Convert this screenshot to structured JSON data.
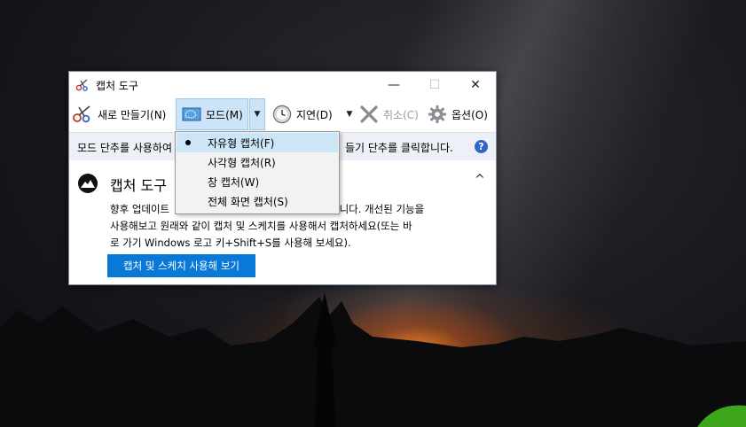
{
  "window": {
    "title": "캡처 도구",
    "minimize": "—",
    "maximize": "☐",
    "close": "✕"
  },
  "toolbar": {
    "new_label": "새로 만들기(N)",
    "mode_label": "모드(M)",
    "delay_label": "지연(D)",
    "cancel_label": "취소(C)",
    "options_label": "옵션(O)",
    "dropdown_caret": "▼"
  },
  "infobar": {
    "text_left": "모드 단추를 사용하여",
    "text_right": "들기 단추를 클릭합니다.",
    "help": "?"
  },
  "panel": {
    "heading": "캡처 도구",
    "collapse": "^",
    "line1_left": "향후 업데이트",
    "line1_right": "됩니다. 개선된 기능을",
    "line2": "사용해보고 원래와 같이 캡처 및 스케치를 사용해서 캡처하세요(또는 바",
    "line3": "로 가기 Windows 로고 키+Shift+S를 사용해 보세요).",
    "cta_label": "캡처 및 스케치 사용해 보기"
  },
  "mode_menu": {
    "items": [
      {
        "label": "자유형 캡처(F)",
        "selected": true
      },
      {
        "label": "사각형 캡처(R)",
        "selected": false
      },
      {
        "label": "창 캡처(W)",
        "selected": false
      },
      {
        "label": "전체 화면 캡처(S)",
        "selected": false
      }
    ]
  },
  "colors": {
    "accent": "#0a78d7",
    "mode_highlight": "#cce4f7",
    "infobar_bg": "#eef0f7",
    "menu_bg": "#f2f2f2"
  },
  "icons": {
    "app": "scissors-icon",
    "new": "scissors-icon",
    "mode": "free-form-snip-icon",
    "delay": "clock-icon",
    "cancel": "x-icon",
    "options": "gear-icon",
    "help": "help-icon",
    "panel": "snip-sketch-icon"
  }
}
